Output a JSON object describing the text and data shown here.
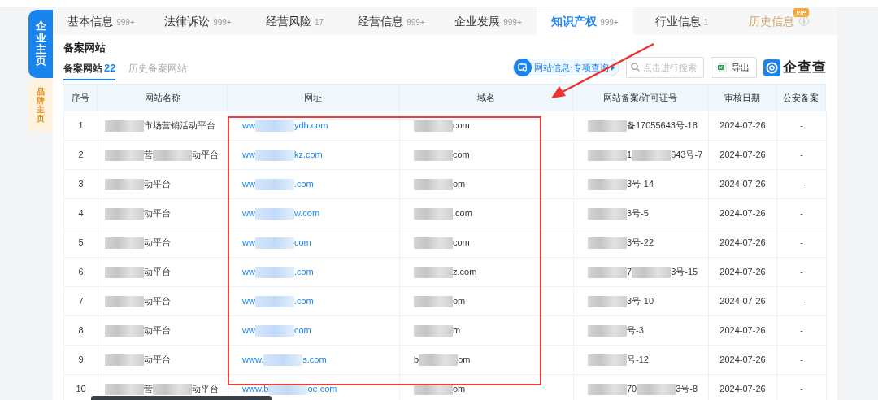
{
  "side_tabs": [
    {
      "label": "企业主页",
      "selected": true
    },
    {
      "label": "品牌主页",
      "selected": false
    }
  ],
  "tabs": [
    {
      "label": "基本信息",
      "count": "999+",
      "selected": false
    },
    {
      "label": "法律诉讼",
      "count": "999+",
      "selected": false
    },
    {
      "label": "经营风险",
      "count": "17",
      "selected": false
    },
    {
      "label": "经营信息",
      "count": "999+",
      "selected": false
    },
    {
      "label": "企业发展",
      "count": "999+",
      "selected": false
    },
    {
      "label": "知识产权",
      "count": "999+",
      "selected": true
    },
    {
      "label": "行业信息",
      "count": "1",
      "selected": false
    },
    {
      "label": "历史信息",
      "badge": "VIP",
      "selected": false,
      "kind": "vip"
    }
  ],
  "section_title": "备案网站",
  "sub_tabs": [
    {
      "label": "备案网站",
      "count": "22",
      "selected": true
    },
    {
      "label": "历史备案网站",
      "selected": false
    }
  ],
  "toolbar": {
    "special_query": "网站信息·专项查询",
    "search": {
      "placeholder": "点击进行搜索"
    },
    "export": "导出",
    "logo": "企查查"
  },
  "table": {
    "columns": [
      "序号",
      "网站名称",
      "网址",
      "域名",
      "网站备案/许可证号",
      "审核日期",
      "公安备案"
    ],
    "rows": [
      {
        "no": "1",
        "name": [
          {
            "kind": "redacted"
          },
          "市场营销活动平台"
        ],
        "url": [
          "ww",
          {
            "kind": "redacted"
          },
          "ydh.com"
        ],
        "domain": [
          {
            "kind": "redacted"
          },
          "com"
        ],
        "license": [
          {
            "kind": "redacted"
          },
          "备17055643号-18"
        ],
        "date": "2024-07-26",
        "police": "-"
      },
      {
        "no": "2",
        "name": [
          {
            "kind": "redacted"
          },
          "营",
          {
            "kind": "redacted"
          },
          "动平台"
        ],
        "url": [
          "ww",
          {
            "kind": "redacted"
          },
          "kz.com"
        ],
        "domain": [
          {
            "kind": "redacted"
          },
          "com"
        ],
        "license": [
          {
            "kind": "redacted"
          },
          "1",
          {
            "kind": "redacted"
          },
          "643号-7"
        ],
        "date": "2024-07-26",
        "police": "-"
      },
      {
        "no": "3",
        "name": [
          {
            "kind": "redacted"
          },
          "动平台"
        ],
        "url": [
          "ww",
          {
            "kind": "redacted"
          },
          ".com"
        ],
        "domain": [
          {
            "kind": "redacted"
          },
          "om"
        ],
        "license": [
          {
            "kind": "redacted"
          },
          "3号-14"
        ],
        "date": "2024-07-26",
        "police": "-"
      },
      {
        "no": "4",
        "name": [
          {
            "kind": "redacted"
          },
          "动平台"
        ],
        "url": [
          "ww",
          {
            "kind": "redacted"
          },
          "w.com"
        ],
        "domain": [
          {
            "kind": "redacted"
          },
          ".com"
        ],
        "license": [
          {
            "kind": "redacted"
          },
          "3号-5"
        ],
        "date": "2024-07-26",
        "police": "-"
      },
      {
        "no": "5",
        "name": [
          {
            "kind": "redacted"
          },
          "动平台"
        ],
        "url": [
          "ww",
          {
            "kind": "redacted"
          },
          "com"
        ],
        "domain": [
          {
            "kind": "redacted"
          },
          "com"
        ],
        "license": [
          {
            "kind": "redacted"
          },
          "3号-22"
        ],
        "date": "2024-07-26",
        "police": "-"
      },
      {
        "no": "6",
        "name": [
          {
            "kind": "redacted"
          },
          "动平台"
        ],
        "url": [
          "ww",
          {
            "kind": "redacted"
          },
          ".com"
        ],
        "domain": [
          {
            "kind": "redacted"
          },
          "z.com"
        ],
        "license": [
          {
            "kind": "redacted"
          },
          "7",
          {
            "kind": "redacted"
          },
          "3号-15"
        ],
        "date": "2024-07-26",
        "police": "-"
      },
      {
        "no": "7",
        "name": [
          {
            "kind": "redacted"
          },
          "动平台"
        ],
        "url": [
          "ww",
          {
            "kind": "redacted"
          },
          ".com"
        ],
        "domain": [
          {
            "kind": "redacted"
          },
          "om"
        ],
        "license": [
          {
            "kind": "redacted"
          },
          "3号-10"
        ],
        "date": "2024-07-26",
        "police": "-"
      },
      {
        "no": "8",
        "name": [
          {
            "kind": "redacted"
          },
          "动平台"
        ],
        "url": [
          "ww",
          {
            "kind": "redacted"
          },
          "com"
        ],
        "domain": [
          {
            "kind": "redacted"
          },
          "m"
        ],
        "license": [
          {
            "kind": "redacted"
          },
          "号-3"
        ],
        "date": "2024-07-26",
        "police": "-"
      },
      {
        "no": "9",
        "name": [
          {
            "kind": "redacted"
          },
          "动平台"
        ],
        "url": [
          "www.",
          {
            "kind": "redacted"
          },
          "s.com"
        ],
        "domain": [
          "b",
          {
            "kind": "redacted"
          },
          "om"
        ],
        "license": [
          {
            "kind": "redacted"
          },
          "号-12"
        ],
        "date": "2024-07-26",
        "police": "-"
      },
      {
        "no": "10",
        "name": [
          {
            "kind": "redacted"
          },
          "营",
          {
            "kind": "redacted"
          },
          "动平台"
        ],
        "url": [
          "www.b",
          {
            "kind": "redacted"
          },
          "oe.com"
        ],
        "domain": [
          {
            "kind": "redacted"
          },
          "om"
        ],
        "license": [
          {
            "kind": "redacted"
          },
          "70",
          {
            "kind": "redacted"
          },
          "3号-8"
        ],
        "date": "2024-07-26",
        "police": "-"
      }
    ]
  }
}
